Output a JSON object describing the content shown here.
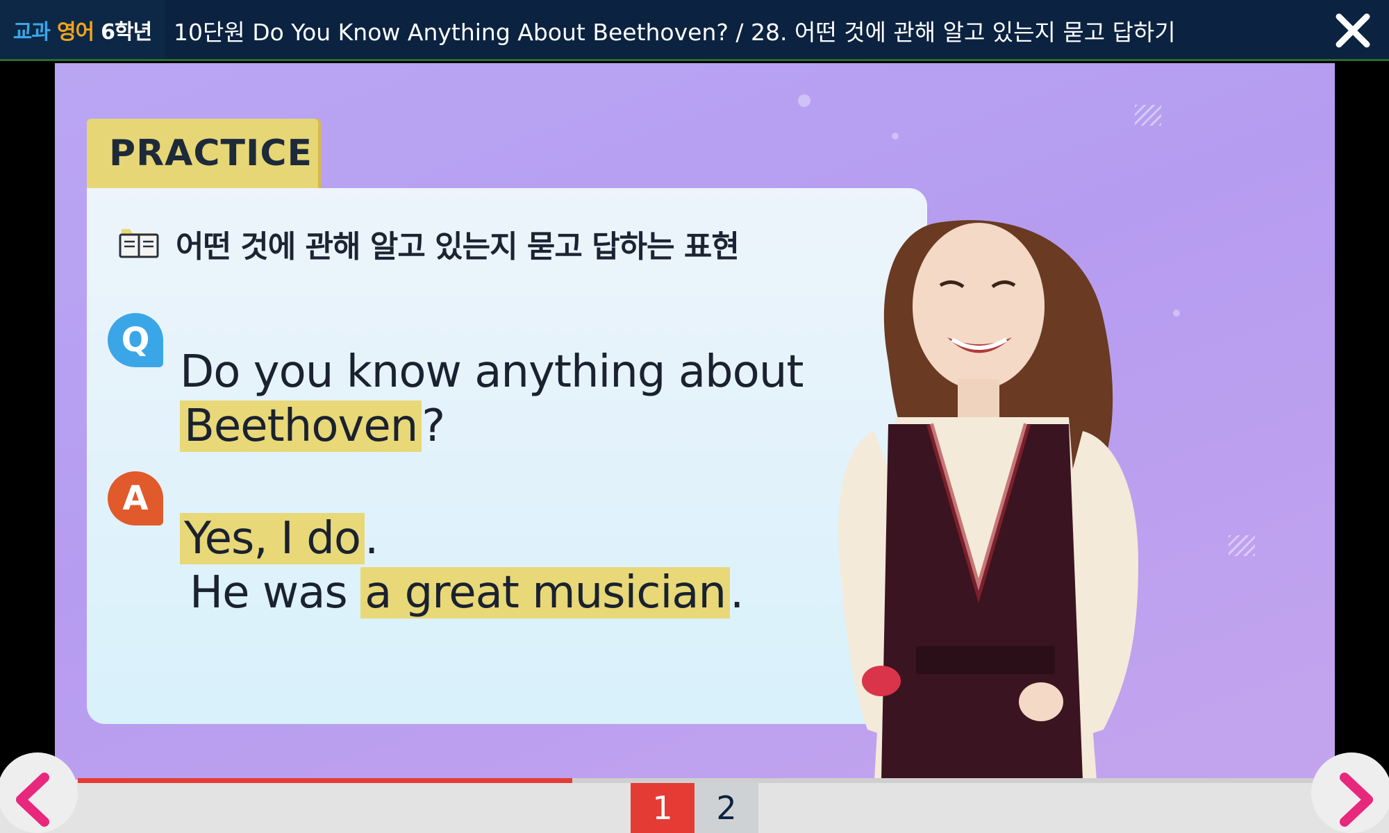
{
  "header": {
    "brand": {
      "part1": "교과",
      "part2": "영어",
      "part3": "6학년"
    },
    "title": "10단원 Do You Know Anything About Beethoven? / 28. 어떤 것에 관해 알고 있는지 묻고 답하기",
    "close_icon": "close-icon"
  },
  "slide": {
    "tab_label": "PRACTICE",
    "heading": "어떤 것에 관해 알고 있는지 묻고 답하는 표현",
    "heading_icon": "book-icon",
    "q_badge": "Q",
    "a_badge": "A",
    "question": {
      "line1": "Do you know anything about",
      "line2_highlight": "Beethoven",
      "line2_rest": "?"
    },
    "answer": {
      "line1_highlight": "Yes, I do",
      "line1_rest": ".",
      "line2_plain": "He was ",
      "line2_highlight": "a great musician",
      "line2_rest": "."
    }
  },
  "player": {
    "progress_fraction": 0.4,
    "pages": [
      "1",
      "2"
    ],
    "current_page": "1",
    "prev_icon": "chevron-left-icon",
    "next_icon": "chevron-right-icon"
  },
  "colors": {
    "topbar": "#0b2240",
    "accent_red": "#e53b35",
    "highlight": "#e8d877",
    "q_badge": "#3aa6e8",
    "a_badge": "#e05a2c",
    "nav_arrow": "#e8287c"
  }
}
